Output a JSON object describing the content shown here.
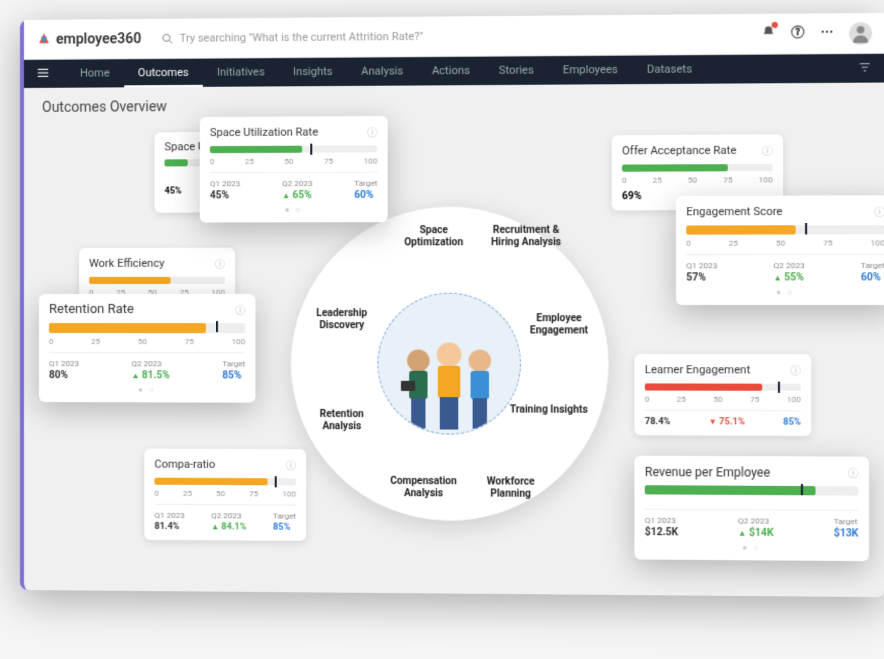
{
  "brand": {
    "name": "employee360"
  },
  "search": {
    "placeholder": "Try searching \"What is the current Attrition Rate?\""
  },
  "nav": {
    "items": [
      "Home",
      "Outcomes",
      "Initiatives",
      "Insights",
      "Analysis",
      "Actions",
      "Stories",
      "Employees",
      "Datasets"
    ],
    "active": 1
  },
  "page": {
    "title": "Outcomes Overview"
  },
  "wheel": {
    "labels": [
      "Space Optimization",
      "Recruitment & Hiring Analysis",
      "Leadership Discovery",
      "Employee Engagement",
      "Retention Analysis",
      "Training Insights",
      "Compensation Analysis",
      "Workforce Planning"
    ]
  },
  "ticks": [
    "0",
    "25",
    "50",
    "75",
    "100"
  ],
  "stat_labels": {
    "q1": "Q1 2023",
    "q2": "Q2 2023",
    "target": "Target"
  },
  "cards": {
    "space_small": {
      "title": "Space Ut",
      "q1": "45%"
    },
    "space_big": {
      "title": "Space Utilization Rate",
      "fill": 55,
      "marker": 60,
      "q1": "45%",
      "q2": "65%",
      "target": "60%",
      "dir": "up"
    },
    "offer": {
      "title": "Offer Acceptance Rate",
      "fill": 70,
      "q1": "69%"
    },
    "engagement": {
      "title": "Engagement Score",
      "fill": 55,
      "marker": 60,
      "q1": "57%",
      "q2": "55%",
      "target": "60%",
      "dir": "up"
    },
    "work_eff": {
      "title": "Work Efficiency",
      "fill": 60
    },
    "retention": {
      "title": "Retention Rate",
      "fill": 80,
      "marker": 85,
      "q1": "80%",
      "q2": "81.5%",
      "target": "85%",
      "dir": "up"
    },
    "learner": {
      "title": "Learner Engagement",
      "fill": 75,
      "q1": "78.4%",
      "q2": "75.1%",
      "target": "85%",
      "dir": "down"
    },
    "compa": {
      "title": "Compa-ratio",
      "fill": 80,
      "q1": "81.4%",
      "q2": "84.1%",
      "target": "85%",
      "dir": "up"
    },
    "revenue": {
      "title": "Revenue per Employee",
      "fill": 80,
      "q1": "$12.5K",
      "q2": "$14K",
      "target": "$13K",
      "dir": "up"
    }
  }
}
